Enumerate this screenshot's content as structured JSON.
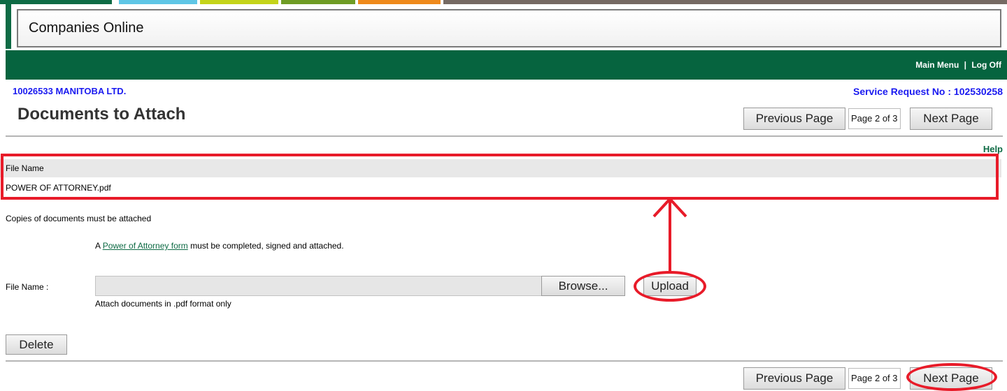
{
  "header": {
    "app_title": "Companies Online",
    "nav_links": {
      "main_menu": "Main Menu",
      "separator": "|",
      "log_off": "Log Off"
    },
    "color_strip": [
      "#0e6b45",
      "#5fc6e6",
      "#c4d41a",
      "#6f9c25",
      "#ef8a1c",
      "#766a63"
    ]
  },
  "company_name": "10026533 MANITOBA LTD.",
  "service_request": "Service Request No : 102530258",
  "page_title": "Documents to Attach",
  "pagination": {
    "previous": "Previous Page",
    "indicator": "Page 2 of 3",
    "next": "Next Page"
  },
  "help": "Help",
  "table": {
    "header": "File Name",
    "rows": [
      "POWER OF ATTORNEY.pdf"
    ]
  },
  "notes": {
    "copies": "Copies of documents must be attached",
    "poa_prefix": "A ",
    "poa_link": "Power of Attorney form",
    "poa_suffix": " must be completed, signed and attached."
  },
  "upload": {
    "file_label": "File Name :",
    "browse": "Browse...",
    "upload": "Upload",
    "hint": "Attach documents in .pdf format only"
  },
  "delete": "Delete",
  "annotation_color": "#e81b29"
}
